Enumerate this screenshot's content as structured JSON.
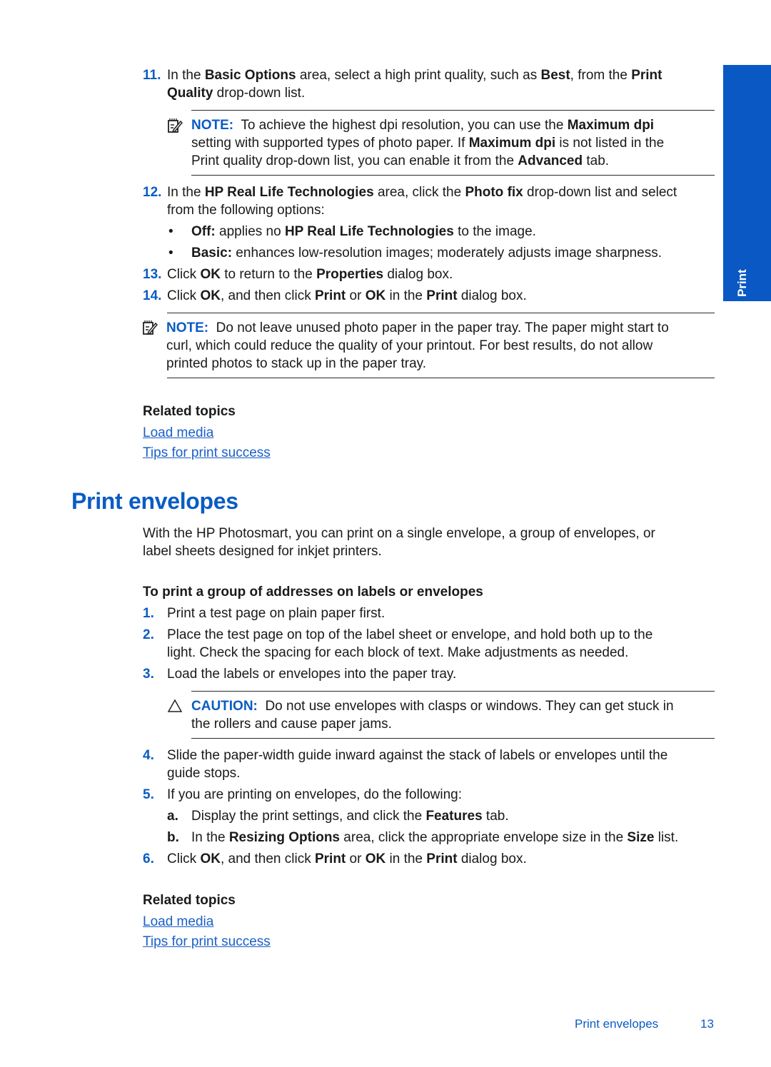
{
  "side_tab": {
    "label": "Print",
    "color": "#0a58c4"
  },
  "steps_part1": [
    {
      "num": "11.",
      "lines": [
        "In the <b>Basic Options</b> area, select a high print quality, such as <b>Best</b>, from the <b>Print</b>",
        "<b>Quality</b> drop-down list."
      ]
    },
    {
      "num": "12.",
      "lines": [
        "In the <b>HP Real Life Technologies</b> area, click the <b>Photo fix</b> drop-down list and select",
        "from the following options:"
      ]
    },
    {
      "num": "13.",
      "lines": [
        "Click <b>OK</b> to return to the <b>Properties</b> dialog box."
      ]
    },
    {
      "num": "14.",
      "lines": [
        "Click <b>OK</b>, and then click <b>Print</b> or <b>OK</b> in the <b>Print</b> dialog box."
      ]
    }
  ],
  "note1": {
    "label": "NOTE:",
    "lines": [
      "To achieve the highest dpi resolution, you can use the <b>Maximum dpi</b>",
      "setting with supported types of photo paper. If <b>Maximum dpi</b> is not listed in the",
      "Print quality drop-down list, you can enable it from the <b>Advanced</b> tab."
    ]
  },
  "options": [
    {
      "bullet": "•",
      "text": "<b>Off:</b> applies no <b>HP Real Life Technologies</b> to the image."
    },
    {
      "bullet": "•",
      "text": "<b>Basic:</b> enhances low-resolution images; moderately adjusts image sharpness."
    }
  ],
  "note2": {
    "label": "NOTE:",
    "lines": [
      "Do not leave unused photo paper in the paper tray. The paper might start to",
      "curl, which could reduce the quality of your printout. For best results, do not allow",
      "printed photos to stack up in the paper tray."
    ]
  },
  "related1": {
    "heading": "Related topics",
    "links": [
      "Load media",
      "Tips for print success"
    ]
  },
  "section": {
    "title": "Print envelopes",
    "intro": [
      "With the HP Photosmart, you can print on a single envelope, a group of envelopes, or",
      "label sheets designed for inkjet printers."
    ],
    "procedure_title": "To print a group of addresses on labels or envelopes"
  },
  "steps_part2": [
    {
      "num": "1.",
      "lines": [
        "Print a test page on plain paper first."
      ]
    },
    {
      "num": "2.",
      "lines": [
        "Place the test page on top of the label sheet or envelope, and hold both up to the",
        "light. Check the spacing for each block of text. Make adjustments as needed."
      ]
    },
    {
      "num": "3.",
      "lines": [
        "Load the labels or envelopes into the paper tray."
      ]
    },
    {
      "num": "4.",
      "lines": [
        "Slide the paper-width guide inward against the stack of labels or envelopes until the",
        "guide stops."
      ]
    },
    {
      "num": "5.",
      "lines": [
        "If you are printing on envelopes, do the following:"
      ]
    },
    {
      "num": "6.",
      "lines": [
        "Click <b>OK</b>, and then click <b>Print</b> or <b>OK</b> in the <b>Print</b> dialog box."
      ]
    }
  ],
  "substeps": [
    {
      "letter": "a.",
      "text": "Display the print settings, and click the <b>Features</b> tab."
    },
    {
      "letter": "b.",
      "text": "In the <b>Resizing Options</b> area, click the appropriate envelope size in the <b>Size</b> list."
    }
  ],
  "caution": {
    "label": "CAUTION:",
    "lines": [
      "Do not use envelopes with clasps or windows. They can get stuck in",
      "the rollers and cause paper jams."
    ]
  },
  "related2": {
    "heading": "Related topics",
    "links": [
      "Load media",
      "Tips for print success"
    ]
  },
  "footer": {
    "section": "Print envelopes",
    "page": "13"
  }
}
